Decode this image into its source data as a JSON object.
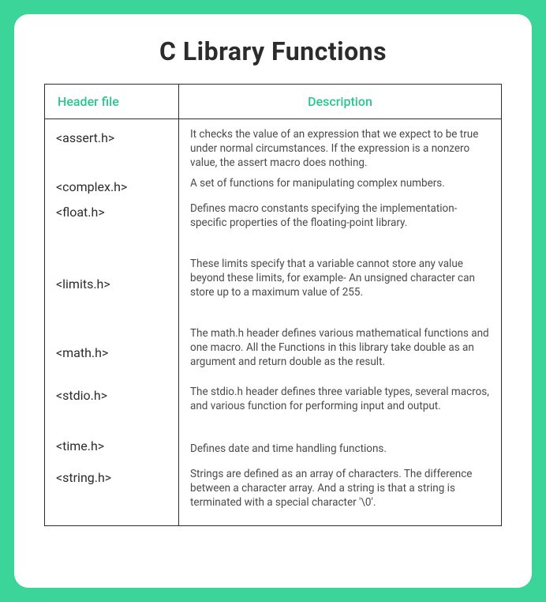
{
  "title": "C Library Functions",
  "columns": {
    "header_file": "Header file",
    "description": "Description"
  },
  "rows": [
    {
      "header": "<assert.h>",
      "description": " It checks the value of an expression that we expect to be true under normal circumstances. If the expression is a nonzero value, the assert macro does nothing."
    },
    {
      "header": "<complex.h>",
      "description": " A set of functions for manipulating complex numbers."
    },
    {
      "header": "<float.h>",
      "description": " Defines macro constants specifying the implementation-specific properties of the floating-point library."
    },
    {
      "header": "<limits.h>",
      "description": "These limits specify that a variable cannot store any value beyond these limits, for example-\nAn unsigned character can store up to a maximum value of 255."
    },
    {
      "header": "<math.h>",
      "description": " The math.h header defines various mathematical functions and one macro. All the Functions in this library take double as an argument and return double as the result."
    },
    {
      "header": "<stdio.h>",
      "description": " The stdio.h header defines three variable types, several macros, and various function for performing input and output."
    },
    {
      "header": "<time.h>",
      "description": " Defines date and time handling functions."
    },
    {
      "header": "<string.h>",
      "description": "Strings are defined as an array of characters. The difference between a character array. And a string is that a string is terminated with a special character '\\0'."
    }
  ]
}
